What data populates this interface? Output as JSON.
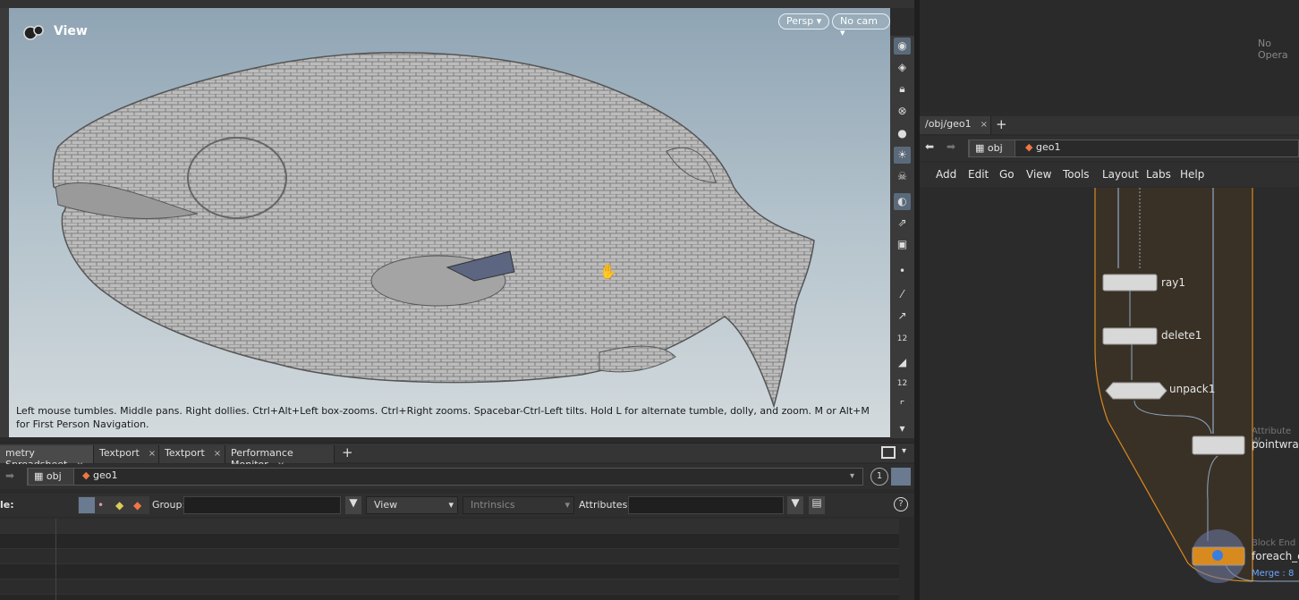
{
  "viewport": {
    "title": "View",
    "persp_label": "Persp",
    "cam_label": "No cam",
    "hint": "Left mouse tumbles. Middle pans. Right dollies. Ctrl+Alt+Left box-zooms. Ctrl+Right zooms. Spacebar-Ctrl-Left tilts. Hold L for alternate tumble, dolly, and zoom. M or Alt+M for First Person Navigation."
  },
  "bottom_tabs": [
    {
      "label": "metry Spreadsheet"
    },
    {
      "label": "Textport"
    },
    {
      "label": "Textport"
    },
    {
      "label": "Performance Monitor"
    }
  ],
  "bottom_path": {
    "obj": "obj",
    "geo": "geo1",
    "badge": "1"
  },
  "filter": {
    "mode_label": "le:",
    "group_label": "Group:",
    "view_label": "View",
    "intrinsics_label": "Intrinsics",
    "attributes_label": "Attributes:"
  },
  "right": {
    "no_op": "No Opera",
    "tab_label": "/obj/geo1",
    "path_obj": "obj",
    "path_geo": "geo1",
    "menu": [
      "Add",
      "Edit",
      "Go",
      "View",
      "Tools",
      "Layout",
      "Labs",
      "Help"
    ],
    "nodes": {
      "ray": "ray1",
      "delete": "delete1",
      "unpack": "unpack1",
      "pointwrangle_type": "Attribute W",
      "pointwrangle": "pointwran",
      "blockend_type": "Block End",
      "blockend": "foreach_e",
      "merge": "Merge : 8"
    }
  },
  "colors": {
    "accent_orange": "#d98a1e",
    "wire": "#8fa9c7"
  }
}
